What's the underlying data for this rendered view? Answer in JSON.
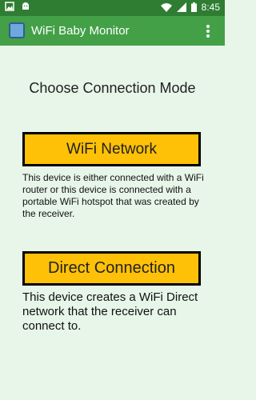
{
  "status_bar": {
    "time": "8:45",
    "icons": [
      "notification-image-icon",
      "android-debug-icon",
      "wifi-icon",
      "cellular-signal-icon",
      "battery-icon"
    ]
  },
  "app_bar": {
    "title": "WiFi Baby Monitor",
    "app_icon": "baby-monitor-app-icon",
    "overflow_icon": "more-vert-icon",
    "color": "#43A047"
  },
  "content": {
    "heading": "Choose Connection Mode",
    "options": [
      {
        "label": "WiFi Network",
        "description": "This device is either connected with a WiFi router or this device is connected with a portable WiFi hotspot that was created by the receiver."
      },
      {
        "label": "Direct Connection",
        "description": "This device creates a WiFi Direct network that the receiver can connect to."
      }
    ]
  },
  "colors": {
    "status_bar": "#2E7D32",
    "background": "#E8F5E9",
    "button": "#FFC107"
  }
}
